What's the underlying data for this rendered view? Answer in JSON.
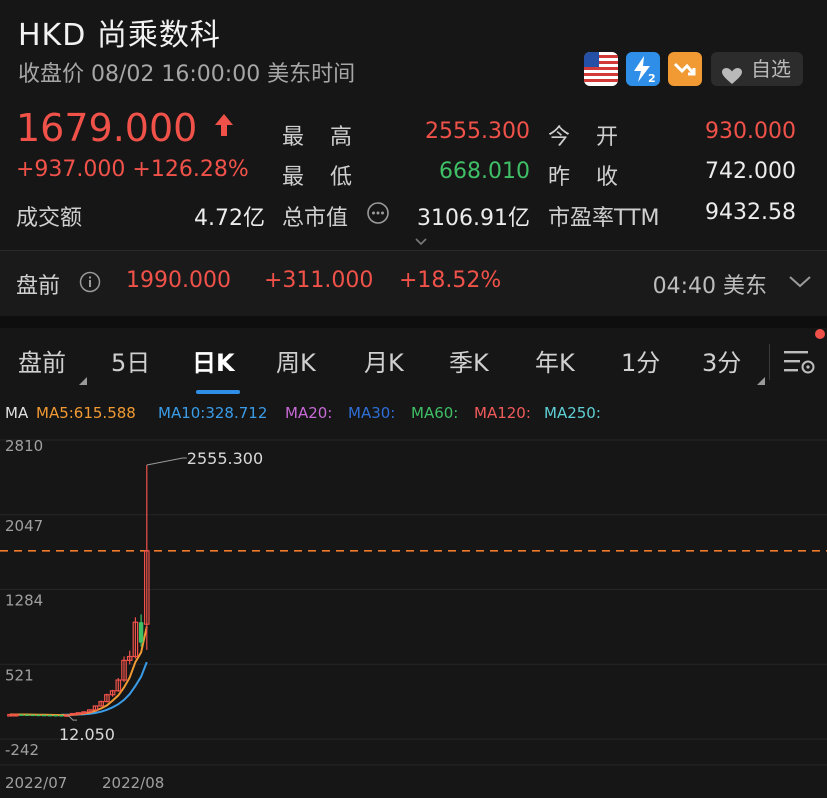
{
  "header": {
    "title": "HKD  尚乘数科",
    "subtitle": "收盘价 08/02 16:00:00 美东时间",
    "watchlist_label": "自选"
  },
  "quote": {
    "price": "1679.000",
    "change": "+937.000  +126.28%",
    "high_label": "最　高",
    "high": "2555.300",
    "open_label": "今　开",
    "open": "930.000",
    "low_label": "最　低",
    "low": "668.010",
    "prev_close_label": "昨　收",
    "prev_close": "742.000",
    "turnover_label": "成交额",
    "turnover": "4.72亿",
    "market_cap_label": "总市值",
    "market_cap": "3106.91亿",
    "pe_label": "市盈率TTM",
    "pe": "9432.58"
  },
  "premarket": {
    "label": "盘前",
    "price": "1990.000",
    "change": "+311.000",
    "pct": "+18.52%",
    "time": "04:40 美东"
  },
  "tabs": [
    "盘前",
    "5日",
    "日K",
    "周K",
    "月K",
    "季K",
    "年K",
    "1分",
    "3分"
  ],
  "active_tab": "日K",
  "ma": {
    "label": "MA",
    "ma5": "MA5:615.588",
    "ma10": "MA10:328.712",
    "ma20": "MA20:",
    "ma30": "MA30:",
    "ma60": "MA60:",
    "ma120": "MA120:",
    "ma250": "MA250:"
  },
  "colors": {
    "up": "#f0524a",
    "down": "#3fbf66",
    "accent": "#2f8fe8",
    "ma5": "#f19a33",
    "ma10": "#3a9ce8",
    "dashed_line": "#f07a2a"
  },
  "icons": [
    "us-flag-icon",
    "bolt-level2-icon",
    "trend-down-icon",
    "heart-icon",
    "info-icon",
    "chevron-down-icon",
    "chart-settings-icon"
  ],
  "chart_data": {
    "type": "candlestick",
    "y_ticks": [
      "2810",
      "2047",
      "1284",
      "521",
      "-242"
    ],
    "ylim": [
      -242,
      2810
    ],
    "x_ticks": [
      "2022/07",
      "2022/08"
    ],
    "annotations": [
      {
        "label": "2555.300",
        "value": 2555.3
      },
      {
        "label": "12.050",
        "value": 12.05
      }
    ],
    "reference_line": 1679.0,
    "candles": [
      {
        "o": 8,
        "h": 10,
        "l": 5,
        "c": 8
      },
      {
        "o": 8,
        "h": 10,
        "l": 6,
        "c": 9
      },
      {
        "o": 9,
        "h": 11,
        "l": 7,
        "c": 8
      },
      {
        "o": 8,
        "h": 10,
        "l": 6,
        "c": 7
      },
      {
        "o": 7,
        "h": 9,
        "l": 5,
        "c": 6
      },
      {
        "o": 6,
        "h": 8,
        "l": 4,
        "c": 5
      },
      {
        "o": 5,
        "h": 7,
        "l": 3,
        "c": 4
      },
      {
        "o": 4,
        "h": 6,
        "l": 2,
        "c": 3
      },
      {
        "o": 3,
        "h": 5,
        "l": 1,
        "c": 2
      },
      {
        "o": 2,
        "h": 4,
        "l": -1,
        "c": 1
      },
      {
        "o": 1,
        "h": 6,
        "l": 0,
        "c": 5
      },
      {
        "o": 5,
        "h": 20,
        "l": 4,
        "c": 18
      },
      {
        "o": 18,
        "h": 30,
        "l": 15,
        "c": 26
      },
      {
        "o": 26,
        "h": 40,
        "l": 22,
        "c": 35
      },
      {
        "o": 35,
        "h": 60,
        "l": 30,
        "c": 55
      },
      {
        "o": 55,
        "h": 100,
        "l": 50,
        "c": 95
      },
      {
        "o": 95,
        "h": 150,
        "l": 90,
        "c": 140
      },
      {
        "o": 140,
        "h": 220,
        "l": 130,
        "c": 210
      },
      {
        "o": 210,
        "h": 260,
        "l": 190,
        "c": 250
      },
      {
        "o": 250,
        "h": 380,
        "l": 240,
        "c": 360
      },
      {
        "o": 360,
        "h": 600,
        "l": 340,
        "c": 560
      },
      {
        "o": 560,
        "h": 660,
        "l": 520,
        "c": 600
      },
      {
        "o": 600,
        "h": 1000,
        "l": 580,
        "c": 950
      },
      {
        "o": 950,
        "h": 1030,
        "l": 700,
        "c": 742
      },
      {
        "o": 930,
        "h": 2555.3,
        "l": 668.01,
        "c": 1679
      }
    ],
    "ma5": [
      8,
      8,
      8,
      8,
      7,
      6,
      5,
      4,
      3,
      2,
      3,
      6,
      11,
      18,
      28,
      46,
      70,
      101,
      150,
      203,
      284,
      386,
      544,
      642,
      905
    ],
    "ma10": [
      null,
      null,
      null,
      null,
      null,
      null,
      null,
      null,
      null,
      5,
      5,
      6,
      8,
      11,
      15,
      24,
      37,
      56,
      82,
      113,
      157,
      216,
      300,
      394,
      543
    ]
  }
}
